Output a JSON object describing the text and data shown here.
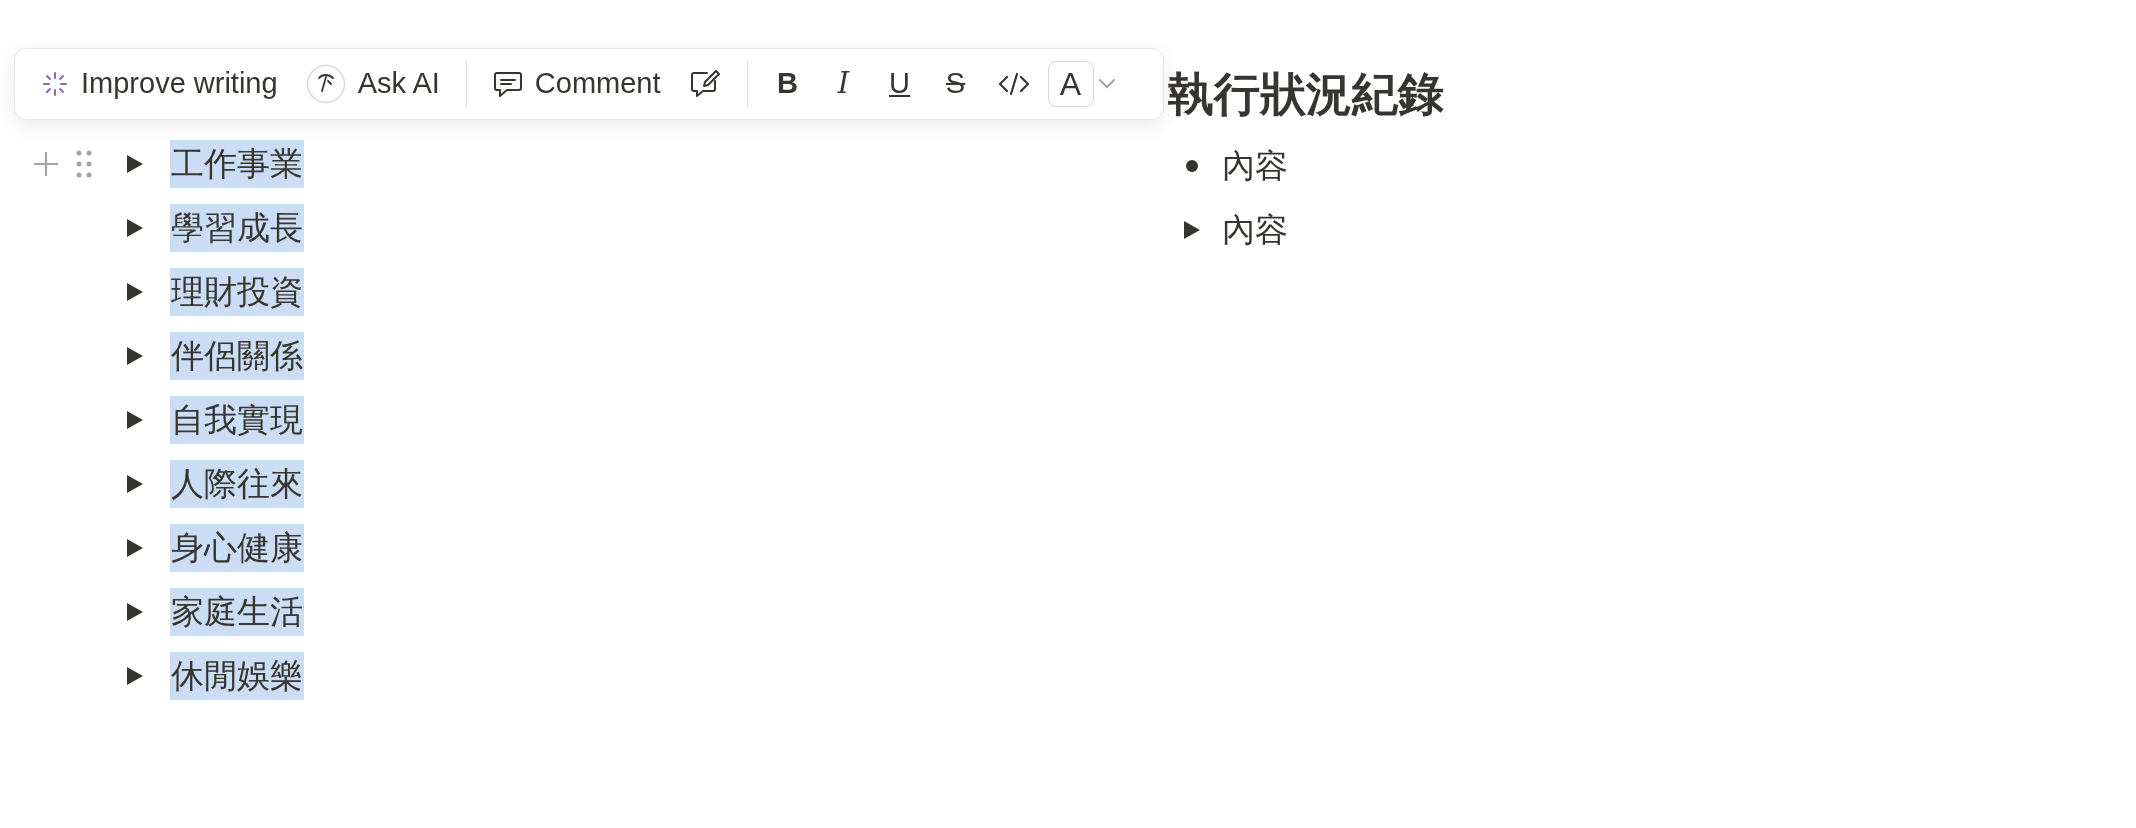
{
  "toolbar": {
    "buttons": [
      {
        "kind": "improve",
        "label": "Improve writing"
      },
      {
        "kind": "ask",
        "label": "Ask AI"
      },
      {
        "kind": "divider"
      },
      {
        "kind": "comment",
        "label": "Comment"
      },
      {
        "kind": "edit"
      },
      {
        "kind": "divider"
      },
      {
        "kind": "bold",
        "label": "B"
      },
      {
        "kind": "italic",
        "label": "I"
      },
      {
        "kind": "underline",
        "label": "U"
      },
      {
        "kind": "strike",
        "label": "S"
      },
      {
        "kind": "code"
      },
      {
        "kind": "color",
        "label": "A"
      }
    ]
  },
  "toggles": [
    {
      "text": "工作事業",
      "selected": true,
      "expanded": false
    },
    {
      "text": "學習成長",
      "selected": true,
      "expanded": false
    },
    {
      "text": "理財投資",
      "selected": true,
      "expanded": false
    },
    {
      "text": "伴侶關係",
      "selected": true,
      "expanded": false
    },
    {
      "text": "自我實現",
      "selected": true,
      "expanded": false
    },
    {
      "text": "人際往來",
      "selected": true,
      "expanded": false
    },
    {
      "text": "身心健康",
      "selected": true,
      "expanded": false
    },
    {
      "text": "家庭生活",
      "selected": true,
      "expanded": false
    },
    {
      "text": "休閒娛樂",
      "selected": true,
      "expanded": false
    }
  ],
  "section": {
    "heading": "執行狀況紀錄",
    "items": [
      {
        "kind": "bullet",
        "text": "內容"
      },
      {
        "kind": "toggle",
        "text": "內容",
        "expanded": false
      }
    ]
  }
}
